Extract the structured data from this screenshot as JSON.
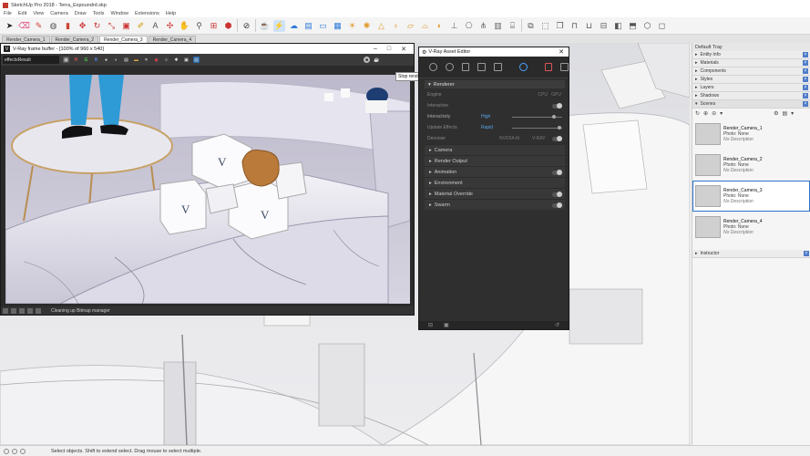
{
  "app": {
    "title": "SketchUp Pro 2018 - Terra_Expoundrd.skp",
    "menu": [
      "File",
      "Edit",
      "View",
      "Camera",
      "Draw",
      "Tools",
      "Window",
      "Extensions",
      "Help"
    ]
  },
  "scene_tabs": [
    "Render_Camera_1",
    "Render_Camera_2",
    "Render_Camera_3",
    "Render_Camera_4"
  ],
  "active_scene_tab": 2,
  "frame_buffer": {
    "title": "V-Ray frame buffer - [100% of 960 x 540]",
    "channel": "effectsResult",
    "tooltip": "Stop rendering",
    "status": "Cleaning up Bitmap manager"
  },
  "asset_editor": {
    "title": "V-Ray Asset Editor",
    "renderer_section": "Renderer",
    "engine_label": "Engine",
    "engine_cpu": "CPU",
    "engine_gpu": "GPU",
    "interactive_label": "Interactive",
    "progressive_label": "Interactivity",
    "progressive_value": "High",
    "update_label": "Update Effects",
    "update_value": "Rapid",
    "denoiser_label": "Denoiser",
    "denoiser_nvidia": "NVIDIA AI",
    "denoiser_vray": "V-RAY",
    "sections": [
      "Camera",
      "Render Output",
      "Animation",
      "Environment",
      "Material Override",
      "Swarm"
    ]
  },
  "tray": {
    "title": "Default Tray",
    "panels": [
      "Entity Info",
      "Materials",
      "Components",
      "Styles",
      "Layers",
      "Shadows",
      "Scenes"
    ],
    "scenes": [
      {
        "name": "Render_Camera_1",
        "photo": "Photo: None",
        "desc": "No Description"
      },
      {
        "name": "Render_Camera_2",
        "photo": "Photo: None",
        "desc": "No Description"
      },
      {
        "name": "Render_Camera_3",
        "photo": "Photo: None",
        "desc": "No Description"
      },
      {
        "name": "Render_Camera_4",
        "photo": "Photo: None",
        "desc": "No Description"
      }
    ],
    "selected_scene": 2,
    "instructor": "Instructor"
  },
  "statusbar": {
    "message": "Select objects. Shift to extend select. Drag mouse to select multiple."
  },
  "colors": {
    "accent": "#4aa3ff",
    "selection": "#2b73c9",
    "vfb_bg": "#2b2b2b",
    "tray_close": "#4f7bc8"
  }
}
